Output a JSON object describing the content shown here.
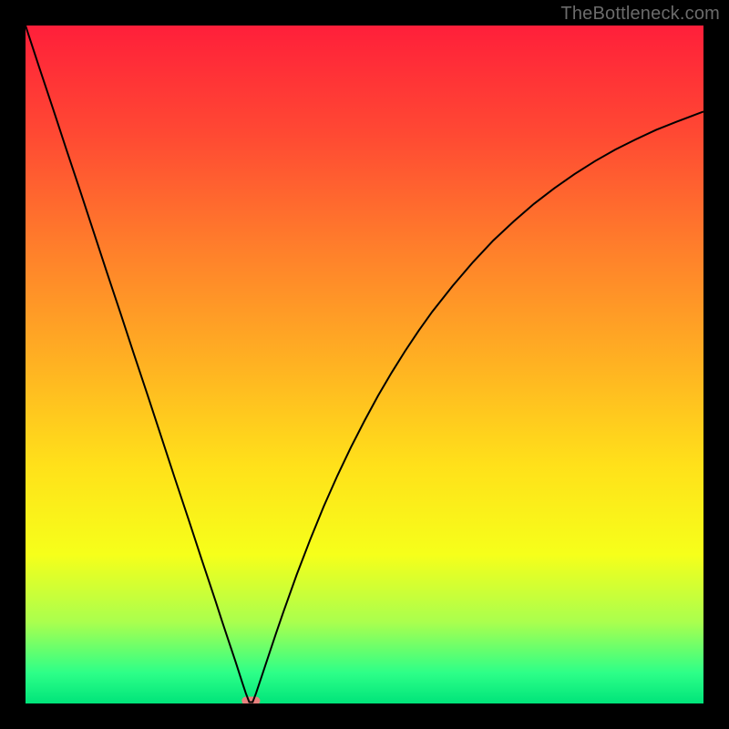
{
  "watermark": {
    "text": "TheBottleneck.com"
  },
  "chart_data": {
    "type": "line",
    "title": "",
    "xlabel": "",
    "ylabel": "",
    "xlim": [
      0,
      100
    ],
    "ylim": [
      0,
      100
    ],
    "grid": false,
    "legend": false,
    "background_gradient_stops": [
      {
        "offset": 0.0,
        "color": "#ff1f3a"
      },
      {
        "offset": 0.16,
        "color": "#ff4933"
      },
      {
        "offset": 0.33,
        "color": "#ff7f2b"
      },
      {
        "offset": 0.5,
        "color": "#ffb222"
      },
      {
        "offset": 0.65,
        "color": "#ffe11a"
      },
      {
        "offset": 0.78,
        "color": "#f6ff1a"
      },
      {
        "offset": 0.88,
        "color": "#aaff4e"
      },
      {
        "offset": 0.955,
        "color": "#2dff88"
      },
      {
        "offset": 1.0,
        "color": "#00e47a"
      }
    ],
    "series": [
      {
        "name": "bottleneck-curve",
        "stroke": "#000000",
        "stroke_width": 2,
        "x": [
          0,
          2,
          4,
          6,
          8,
          10,
          12,
          14,
          16,
          18,
          20,
          22,
          24,
          26,
          28,
          29,
          30,
          31,
          32,
          32.5,
          33,
          33.5,
          34,
          34.5,
          35,
          36,
          37,
          38,
          40,
          42,
          44,
          46,
          48,
          50,
          52,
          54,
          56,
          58,
          60,
          63,
          66,
          69,
          72,
          75,
          78,
          81,
          84,
          87,
          90,
          93,
          96,
          100
        ],
        "y": [
          100,
          93.9,
          87.9,
          81.8,
          75.8,
          69.7,
          63.6,
          57.6,
          51.5,
          45.5,
          39.4,
          33.3,
          27.3,
          21.2,
          15.2,
          12.1,
          9.1,
          6.1,
          3.0,
          1.5,
          0.2,
          0.2,
          1.5,
          3.0,
          4.5,
          7.5,
          10.5,
          13.4,
          19.0,
          24.2,
          29.1,
          33.6,
          37.8,
          41.7,
          45.4,
          48.8,
          52.0,
          55.0,
          57.8,
          61.6,
          65.1,
          68.3,
          71.1,
          73.7,
          76.0,
          78.1,
          80.0,
          81.7,
          83.2,
          84.6,
          85.8,
          87.3
        ]
      }
    ],
    "marker": {
      "name": "sweet-spot-marker",
      "x_range": [
        32.5,
        34.0
      ],
      "y": 0.4,
      "color": "#e9807e"
    }
  }
}
